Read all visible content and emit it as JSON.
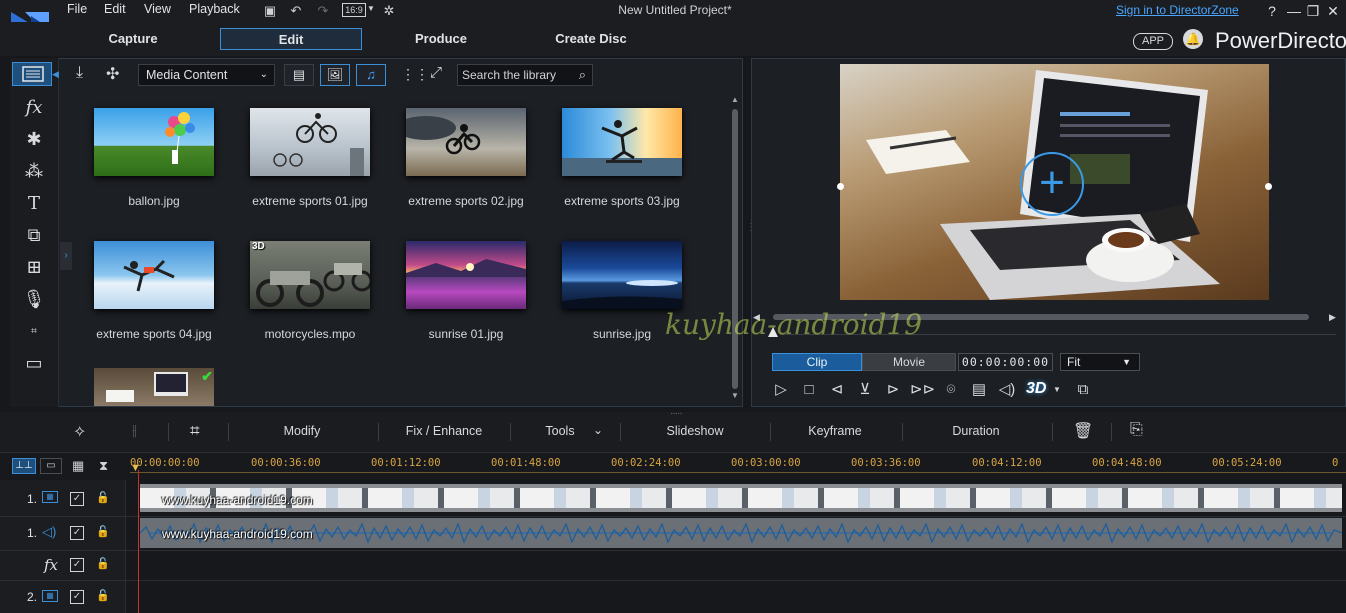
{
  "menu": [
    "File",
    "Edit",
    "View",
    "Playback"
  ],
  "toolbar": {
    "aspect": "16:9"
  },
  "window": {
    "title": "New Untitled Project*",
    "signin": "Sign in to DirectorZone",
    "help": "?",
    "min": "—",
    "restore": "❐",
    "close": "✕"
  },
  "modes": [
    "Capture",
    "Edit",
    "Produce",
    "Create Disc"
  ],
  "brand": {
    "app_badge": "APP",
    "name": "PowerDirector"
  },
  "library": {
    "media_select": "Media Content",
    "search_placeholder": "Search the library",
    "items": [
      {
        "label": "ballon.jpg"
      },
      {
        "label": "extreme sports 01.jpg"
      },
      {
        "label": "extreme sports 02.jpg"
      },
      {
        "label": "extreme sports 03.jpg"
      },
      {
        "label": "extreme sports 04.jpg"
      },
      {
        "label": "motorcycles.mpo",
        "badge": "3D"
      },
      {
        "label": "sunrise 01.jpg"
      },
      {
        "label": "sunrise.jpg"
      }
    ]
  },
  "preview": {
    "seg_clip": "Clip",
    "seg_movie": "Movie",
    "timecode": "00:00:00:00",
    "fit": "Fit",
    "mode_3d": "3D"
  },
  "edit_toolbar": [
    "Modify",
    "Fix / Enhance",
    "Tools",
    "Slideshow",
    "Keyframe",
    "Duration"
  ],
  "timeline": {
    "ticks": [
      "00:00:00:00",
      "00:00:36:00",
      "00:01:12:00",
      "00:01:48:00",
      "00:02:24:00",
      "00:03:00:00",
      "00:03:36:00",
      "00:04:12:00",
      "00:04:48:00",
      "00:05:24:00"
    ],
    "track_numbers": [
      "1.",
      "1.",
      "2."
    ],
    "video_label": "www.kuyhaa-android19.com",
    "audio_label": "www.kuyhaa-android19.com",
    "fx_label": "fx"
  },
  "watermark": "kuyhaa-android19"
}
